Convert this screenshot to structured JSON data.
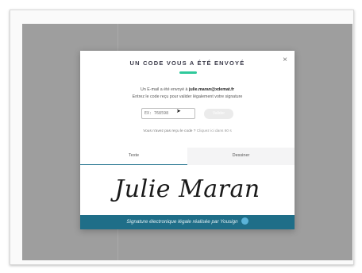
{
  "modal": {
    "title": "UN CODE VOUS A ÉTÉ ENVOYÉ",
    "close_icon": "×",
    "email_prefix": "Un E-mail a été envoyé à ",
    "email_address": "julie.maran@xdemat.fr",
    "instruction": "Entrez le code reçu pour valider légalement votre signature",
    "code_placeholder": "EX: 768598",
    "validate_label": "Valider",
    "resend_prefix": "Vous n'avez pas reçu le code ? ",
    "resend_link": "Cliquez ici dans 60 s"
  },
  "signature": {
    "tabs": [
      {
        "label": "Texte",
        "active": true
      },
      {
        "label": "Dessiner",
        "active": false
      }
    ],
    "name": "Julie Maran"
  },
  "footer": {
    "text": "Signature électronique légale réalisée par Yousign",
    "icon": "yousign-logo-icon"
  },
  "colors": {
    "accent": "#2fc99b",
    "banner": "#1f6e88",
    "overlay": "#9e9e9e"
  }
}
